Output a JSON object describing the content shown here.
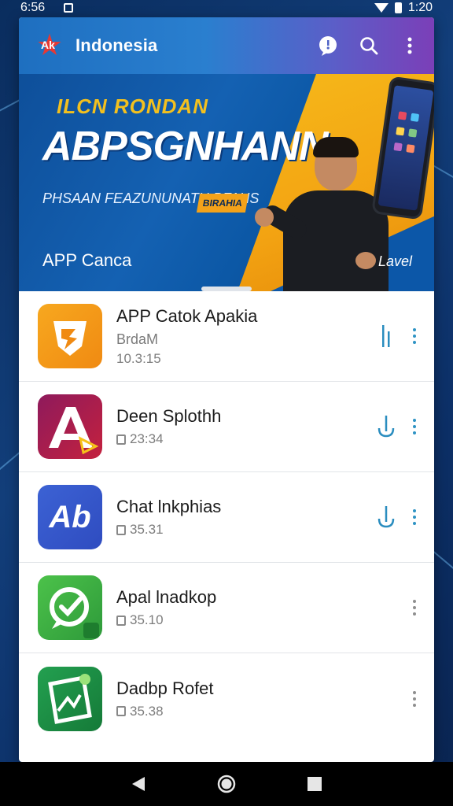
{
  "status_bar": {
    "time": "6:56",
    "clock_right": "1:20"
  },
  "app_bar": {
    "title": "Indonesia",
    "logo_text": "Ak"
  },
  "banner": {
    "line1": "ILCN RONDAN",
    "line2": "ABPSGNHANN",
    "line3": "PHSAAN FEAZUNUNATH PFAHS",
    "tag": "BIRAHIA",
    "caption": "APP Canca",
    "right_label": "Lavel"
  },
  "apps": [
    {
      "name": "APP Catok Apakia",
      "sub1": "BrdaM",
      "sub2": "10.3:15",
      "has_lock": false,
      "download": "bar",
      "icon_color": "#f59a1c"
    },
    {
      "name": "Deen Splothh",
      "sub1": "",
      "sub2": "23:34",
      "has_lock": true,
      "download": "arrow",
      "icon_color": "#a0195a"
    },
    {
      "name": "Chat lnkphias",
      "sub1": "",
      "sub2": "35.31",
      "has_lock": true,
      "download": "arrow",
      "icon_color": "#3a5fd0"
    },
    {
      "name": "Apal lnadkop",
      "sub1": "",
      "sub2": "35.10",
      "has_lock": true,
      "download": "none",
      "icon_color": "#3ab04a"
    },
    {
      "name": "Dadbp Rofet",
      "sub1": "",
      "sub2": "35.38",
      "has_lock": true,
      "download": "none",
      "icon_color": "#1e8e4a"
    }
  ]
}
